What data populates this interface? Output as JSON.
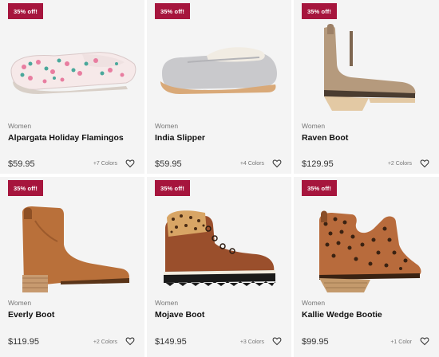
{
  "products": [
    {
      "badge": "35% off!",
      "gender": "Women",
      "name": "Alpargata Holiday Flamingos",
      "price": "$59.95",
      "colors": "+7 Colors",
      "image_icon": "flamingo-slip-on-shoe"
    },
    {
      "badge": "35% off!",
      "gender": "Women",
      "name": "India Slipper",
      "price": "$59.95",
      "colors": "+4 Colors",
      "image_icon": "grey-slipper"
    },
    {
      "badge": "35% off!",
      "gender": "Women",
      "name": "Raven Boot",
      "price": "$129.95",
      "colors": "+2 Colors",
      "image_icon": "taupe-wedge-boot"
    },
    {
      "badge": "35% off!",
      "gender": "Women",
      "name": "Everly Boot",
      "price": "$119.95",
      "colors": "+2 Colors",
      "image_icon": "tan-heeled-boot"
    },
    {
      "badge": "35% off!",
      "gender": "Women",
      "name": "Mojave Boot",
      "price": "$149.95",
      "colors": "+3 Colors",
      "image_icon": "leopard-hiker-boot"
    },
    {
      "badge": "35% off!",
      "gender": "Women",
      "name": "Kallie Wedge Bootie",
      "price": "$99.95",
      "colors": "+1 Color",
      "image_icon": "leopard-wedge-bootie"
    }
  ],
  "theme": {
    "badge_color": "#a6153d",
    "card_bg": "#f4f4f4"
  }
}
